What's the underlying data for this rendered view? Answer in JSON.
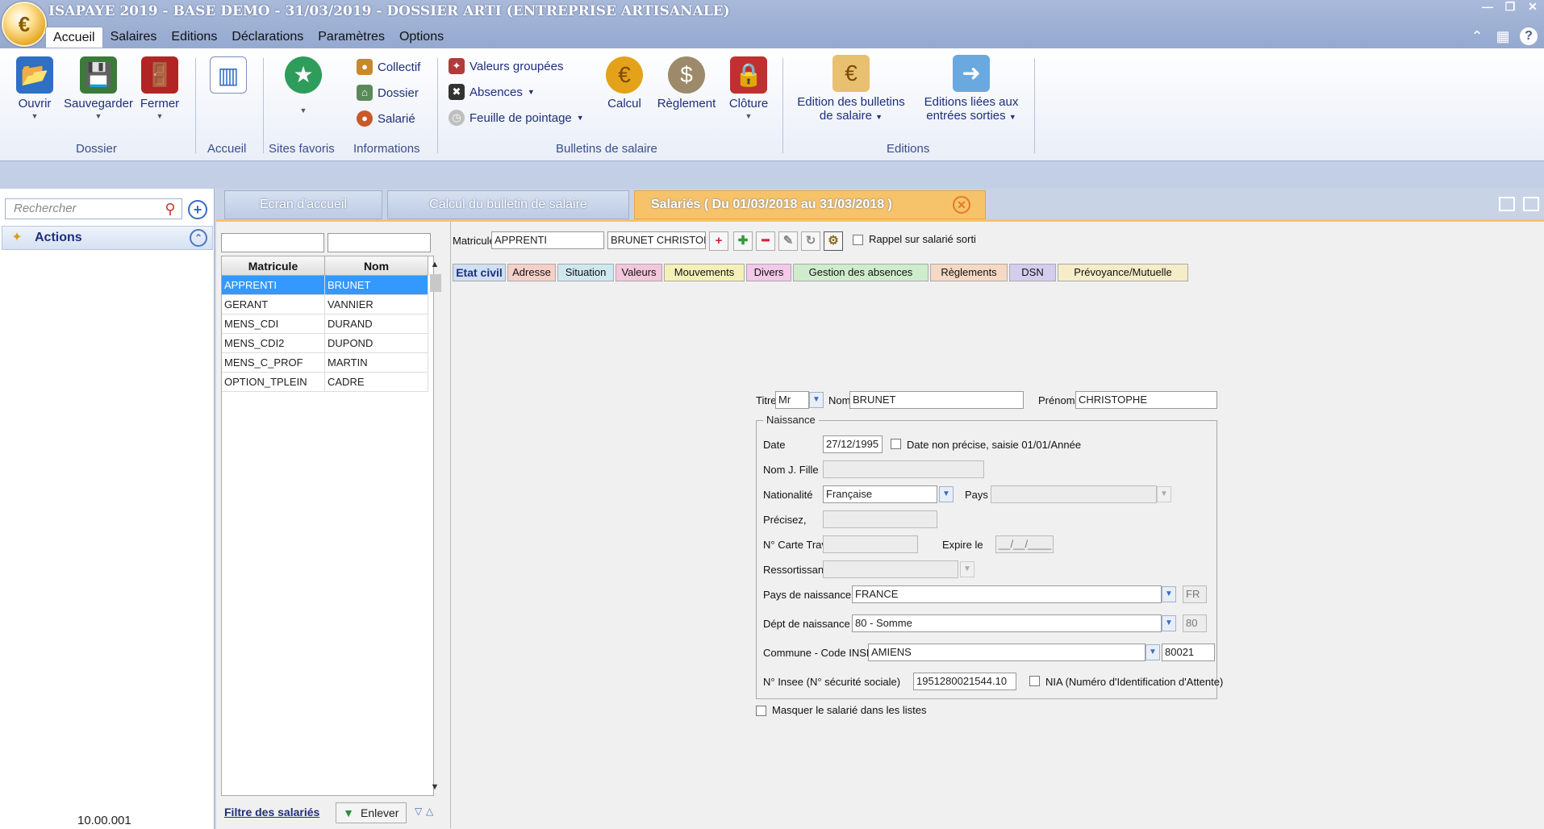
{
  "window": {
    "title": "ISAPAYE 2019 - BASE DEMO - 31/03/2019 - DOSSIER ARTI (ENTREPRISE ARTISANALE)",
    "minimize_glyph": "—",
    "restore_glyph": "❐",
    "close_glyph": "✕"
  },
  "app_logo": "€",
  "menu": [
    "Accueil",
    "Salaires",
    "Editions",
    "Déclarations",
    "Paramètres",
    "Options"
  ],
  "ribbon_right": {
    "collapse_glyph": "⌃",
    "calculator_glyph": "▦",
    "help_glyph": "?"
  },
  "ribbon": {
    "groups": [
      {
        "label": "Dossier",
        "buttons": [
          "Ouvrir",
          "Sauvegarder",
          "Fermer"
        ]
      },
      {
        "label": "Accueil"
      },
      {
        "label": "Sites favoris"
      },
      {
        "label": "Informations",
        "buttons": [
          "Collectif",
          "Dossier",
          "Salarié"
        ]
      },
      {
        "label": "Bulletins de salaire",
        "small_buttons": [
          "Valeurs groupées",
          "Absences",
          "Feuille de pointage"
        ],
        "buttons": [
          "Calcul",
          "Règlement",
          "Clôture"
        ]
      },
      {
        "label": "Editions",
        "buttons": [
          "Edition des bulletins",
          "de salaire",
          "Editions liées aux",
          "entrées sorties"
        ]
      }
    ],
    "colors": {
      "ouvrir": "#2f6fc4",
      "sauvegarder": "#3b7a3a",
      "fermer": "#b32424",
      "calcul": "#e3a21a"
    }
  },
  "left_panel": {
    "search_placeholder": "Rechercher",
    "actions_label": "Actions",
    "version": "10.00.001"
  },
  "tabs": [
    {
      "label": "Ecran d'accueil"
    },
    {
      "label": "Calcul du bulletin de salaire"
    },
    {
      "label": "Salariés ( Du 01/03/2018 au 31/03/2018 )",
      "active": true
    }
  ],
  "employee_list": {
    "columns": [
      "Matricule",
      "Nom"
    ],
    "rows": [
      {
        "matricule": "APPRENTI",
        "nom": "BRUNET",
        "selected": true
      },
      {
        "matricule": "GERANT",
        "nom": "VANNIER"
      },
      {
        "matricule": "MENS_CDI",
        "nom": "DURAND"
      },
      {
        "matricule": "MENS_CDI2",
        "nom": "DUPOND"
      },
      {
        "matricule": "MENS_C_PROF",
        "nom": "MARTIN"
      },
      {
        "matricule": "OPTION_TPLEIN",
        "nom": "CADRE"
      }
    ],
    "footer": {
      "filter_label": "Filtre des salariés",
      "remove_label": "Enlever"
    }
  },
  "detail": {
    "matricule_label": "Matricule",
    "matricule_value": "APPRENTI",
    "name_display": "BRUNET CHRISTOF",
    "toolbar_glyphs": [
      "+",
      "✚",
      "━",
      "✎",
      "↻",
      "⚙"
    ],
    "rappel_label": "Rappel sur salarié sorti",
    "subtabs": [
      {
        "label": "Etat civil",
        "color": "#cfe0f5",
        "active": true
      },
      {
        "label": "Adresse",
        "color": "#f6d0c8"
      },
      {
        "label": "Situation",
        "color": "#cfe8f0"
      },
      {
        "label": "Valeurs",
        "color": "#f3c6dc"
      },
      {
        "label": "Mouvements",
        "color": "#f5f0b8"
      },
      {
        "label": "Divers",
        "color": "#f3c8e8"
      },
      {
        "label": "Gestion des absences",
        "color": "#cfeccc"
      },
      {
        "label": "Règlements",
        "color": "#f5d9c4"
      },
      {
        "label": "DSN",
        "color": "#d4cdee"
      },
      {
        "label": "Prévoyance/Mutuelle",
        "color": "#f5ecc8"
      }
    ],
    "form": {
      "titre_label": "Titre",
      "titre_value": "Mr",
      "nom_label": "Nom",
      "nom_value": "BRUNET",
      "prenom_label": "Prénom",
      "prenom_value": "CHRISTOPHE",
      "naissance_legend": "Naissance",
      "date_label": "Date",
      "date_value": "27/12/1995",
      "date_non_precise_label": "Date non précise, saisie 01/01/Année",
      "nom_jfille_label": "Nom J. Fille",
      "nom_jfille_value": "",
      "nationalite_label": "Nationalité",
      "nationalite_value": "Française",
      "pays_label": "Pays",
      "pays_value": "",
      "precisez_label": "Précisez,",
      "precisez_value": "",
      "carte_trav_label": "N° Carte Trav.",
      "carte_trav_value": "",
      "expire_label": "Expire le",
      "expire_value": "__/__/____",
      "ressortissant_label": "Ressortissant",
      "ressortissant_value": "",
      "pays_naissance_label": "Pays de naissance",
      "pays_naissance_value": "FRANCE",
      "pays_naissance_code": "FR",
      "dept_naissance_label": "Dépt de naissance",
      "dept_naissance_value": "80 - Somme",
      "dept_naissance_code": "80",
      "commune_label": "Commune - Code INSEE",
      "commune_value": "AMIENS",
      "commune_code": "80021",
      "insee_label": "N° Insee (N° sécurité sociale)",
      "insee_value": "1951280021544.10",
      "nia_label": "NIA (Numéro d'Identification d'Attente)",
      "masquer_label": "Masquer le salarié dans les listes"
    }
  }
}
